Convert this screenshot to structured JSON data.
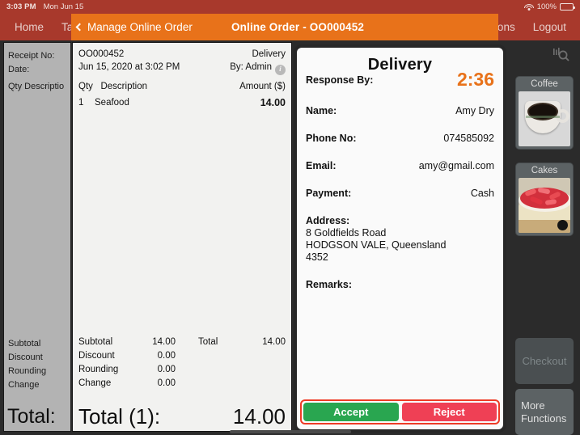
{
  "statusbar": {
    "time": "3:03 PM",
    "date": "Mon Jun 15",
    "battery_percent": "100%",
    "wifi_icon": "wifi-icon",
    "battery_icon": "battery-icon"
  },
  "topnav": {
    "items_left": [
      "Home",
      "Table"
    ],
    "items_right": [
      "ions",
      "Logout"
    ]
  },
  "modal_header": {
    "back_label": "Manage Online Order",
    "back_icon": "chevron-left-icon",
    "title": "Online Order - OO000452",
    "bg_color": "#e8721a"
  },
  "ghost_panel": {
    "receipt_no_label": "Receipt No:",
    "date_label": "Date:",
    "columns": "Qty  Descriptio",
    "summary": [
      "Subtotal",
      "Discount",
      "Rounding",
      "Change"
    ],
    "total_label": "Total:"
  },
  "receipt": {
    "number": "OO000452",
    "type": "Delivery",
    "datetime": "Jun 15, 2020 at 3:02 PM",
    "by": "By: Admin",
    "info_icon": "info-icon",
    "col_qty": "Qty",
    "col_desc": "Description",
    "col_amount": "Amount ($)",
    "lines": [
      {
        "qty": "1",
        "description": "Seafood",
        "amount": "14.00"
      }
    ],
    "summary_left": [
      {
        "label": "Subtotal",
        "value": "14.00"
      },
      {
        "label": "Discount",
        "value": "0.00"
      },
      {
        "label": "Rounding",
        "value": "0.00"
      },
      {
        "label": "Change",
        "value": "0.00"
      }
    ],
    "summary_right": [
      {
        "label": "Total",
        "value": "14.00"
      }
    ],
    "grand_label": "Total (1):",
    "grand_value": "14.00"
  },
  "modal": {
    "title": "Delivery",
    "response_by_label": "Response By:",
    "timer": "2:36",
    "timer_color": "#e8721a",
    "fields": [
      {
        "label": "Name:",
        "value": "Amy Dry"
      },
      {
        "label": "Phone No:",
        "value": "074585092"
      },
      {
        "label": "Email:",
        "value": "amy@gmail.com"
      },
      {
        "label": "Payment:",
        "value": "Cash"
      }
    ],
    "address_label": "Address:",
    "address_lines": [
      "8 Goldfields Road",
      "HODGSON VALE, Queensland",
      "4352"
    ],
    "remarks_label": "Remarks:",
    "remarks_value": "",
    "accept_label": "Accept",
    "reject_label": "Reject",
    "accept_color": "#29a650",
    "reject_color": "#ef4055",
    "highlight_color": "#ee3b26"
  },
  "rail": {
    "search_icon": "search-icon",
    "tiles": [
      {
        "label": "Coffee",
        "image": "coffee-cup-image"
      },
      {
        "label": "Cakes",
        "image": "strawberry-cake-image"
      }
    ],
    "checkout_label": "Checkout",
    "more_functions_label": "More\nFunctions",
    "more_functions_line1": "More",
    "more_functions_line2": "Functions"
  }
}
